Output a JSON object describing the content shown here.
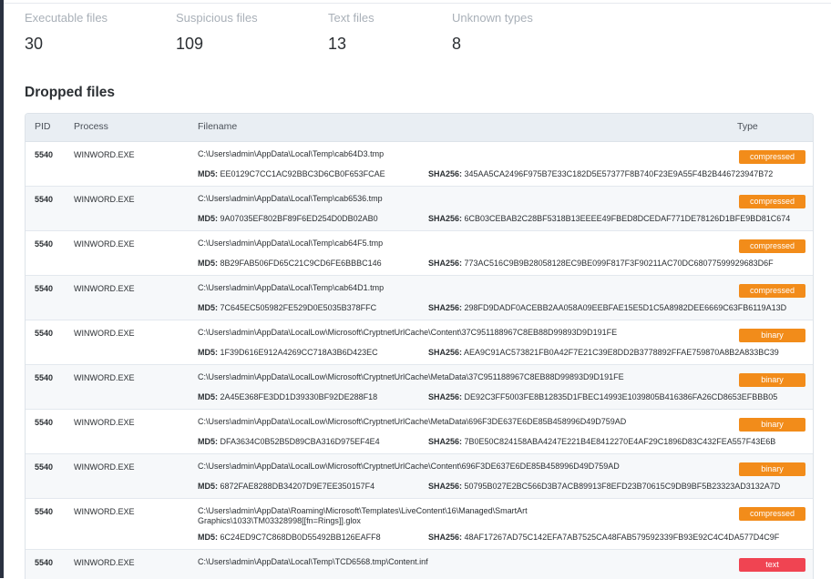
{
  "stats": [
    {
      "label": "Executable files",
      "value": "30"
    },
    {
      "label": "Suspicious files",
      "value": "109"
    },
    {
      "label": "Text files",
      "value": "13"
    },
    {
      "label": "Unknown types",
      "value": "8"
    }
  ],
  "section_title": "Dropped files",
  "table": {
    "headers": {
      "pid": "PID",
      "process": "Process",
      "filename": "Filename",
      "type": "Type"
    },
    "md5_label": "MD5:",
    "sha256_label": "SHA256:",
    "rows": [
      {
        "pid": "5540",
        "process": "WINWORD.EXE",
        "filename": "C:\\Users\\admin\\AppData\\Local\\Temp\\cab64D3.tmp",
        "md5": "EE0129C7CC1AC92BBC3D6CB0F653FCAE",
        "sha256": "345AA5CA2496F975B7E33C182D5E57377F8B740F23E9A55F4B2B446723947B72",
        "type": "compressed"
      },
      {
        "pid": "5540",
        "process": "WINWORD.EXE",
        "filename": "C:\\Users\\admin\\AppData\\Local\\Temp\\cab6536.tmp",
        "md5": "9A07035EF802BF89F6ED254D0DB02AB0",
        "sha256": "6CB03CEBAB2C28BF5318B13EEEE49FBED8DCEDAF771DE78126D1BFE9BD81C674",
        "type": "compressed"
      },
      {
        "pid": "5540",
        "process": "WINWORD.EXE",
        "filename": "C:\\Users\\admin\\AppData\\Local\\Temp\\cab64F5.tmp",
        "md5": "8B29FAB506FD65C21C9CD6FE6BBBC146",
        "sha256": "773AC516C9B9B28058128EC9BE099F817F3F90211AC70DC68077599929683D6F",
        "type": "compressed"
      },
      {
        "pid": "5540",
        "process": "WINWORD.EXE",
        "filename": "C:\\Users\\admin\\AppData\\Local\\Temp\\cab64D1.tmp",
        "md5": "7C645EC505982FE529D0E5035B378FFC",
        "sha256": "298FD9DADF0ACEBB2AA058A09EEBFAE15E5D1C5A8982DEE6669C63FB6119A13D",
        "type": "compressed"
      },
      {
        "pid": "5540",
        "process": "WINWORD.EXE",
        "filename": "C:\\Users\\admin\\AppData\\LocalLow\\Microsoft\\CryptnetUrlCache\\Content\\37C951188967C8EB88D99893D9D191FE",
        "md5": "1F39D616E912A4269CC718A3B6D423EC",
        "sha256": "AEA9C91AC573821FB0A42F7E21C39E8DD2B3778892FFAE759870A8B2A833BC39",
        "type": "binary"
      },
      {
        "pid": "5540",
        "process": "WINWORD.EXE",
        "filename": "C:\\Users\\admin\\AppData\\LocalLow\\Microsoft\\CryptnetUrlCache\\MetaData\\37C951188967C8EB88D99893D9D191FE",
        "md5": "2A45E368FE3DD1D39330BF92DE288F18",
        "sha256": "DE92C3FF5003FE8B12835D1FBEC14993E1039805B416386FA26CD8653EFBBB05",
        "type": "binary"
      },
      {
        "pid": "5540",
        "process": "WINWORD.EXE",
        "filename": "C:\\Users\\admin\\AppData\\LocalLow\\Microsoft\\CryptnetUrlCache\\MetaData\\696F3DE637E6DE85B458996D49D759AD",
        "md5": "DFA3634C0B52B5D89CBA316D975EF4E4",
        "sha256": "7B0E50C824158ABA4247E221B4E8412270E4AF29C1896D83C432FEA557F43E6B",
        "type": "binary"
      },
      {
        "pid": "5540",
        "process": "WINWORD.EXE",
        "filename": "C:\\Users\\admin\\AppData\\LocalLow\\Microsoft\\CryptnetUrlCache\\Content\\696F3DE637E6DE85B458996D49D759AD",
        "md5": "6872FAE8288DB34207D9E7EE350157F4",
        "sha256": "50795B027E2BC566D3B7ACB89913F8EFD23B70615C9DB9BF5B23323AD3132A7D",
        "type": "binary"
      },
      {
        "pid": "5540",
        "process": "WINWORD.EXE",
        "filename": "C:\\Users\\admin\\AppData\\Roaming\\Microsoft\\Templates\\LiveContent\\16\\Managed\\SmartArt Graphics\\1033\\TM03328998[[fn=Rings]].glox",
        "md5": "6C24ED9C7C868DB0D55492BB126EAFF8",
        "sha256": "48AF17267AD75C142EFA7AB7525CA48FAB579592339FB93E92C4C4DA577D4C9F",
        "type": "compressed"
      },
      {
        "pid": "5540",
        "process": "WINWORD.EXE",
        "filename": "C:\\Users\\admin\\AppData\\Local\\Temp\\TCD6568.tmp\\Content.inf",
        "md5": "",
        "sha256": "",
        "type": "text"
      }
    ]
  }
}
